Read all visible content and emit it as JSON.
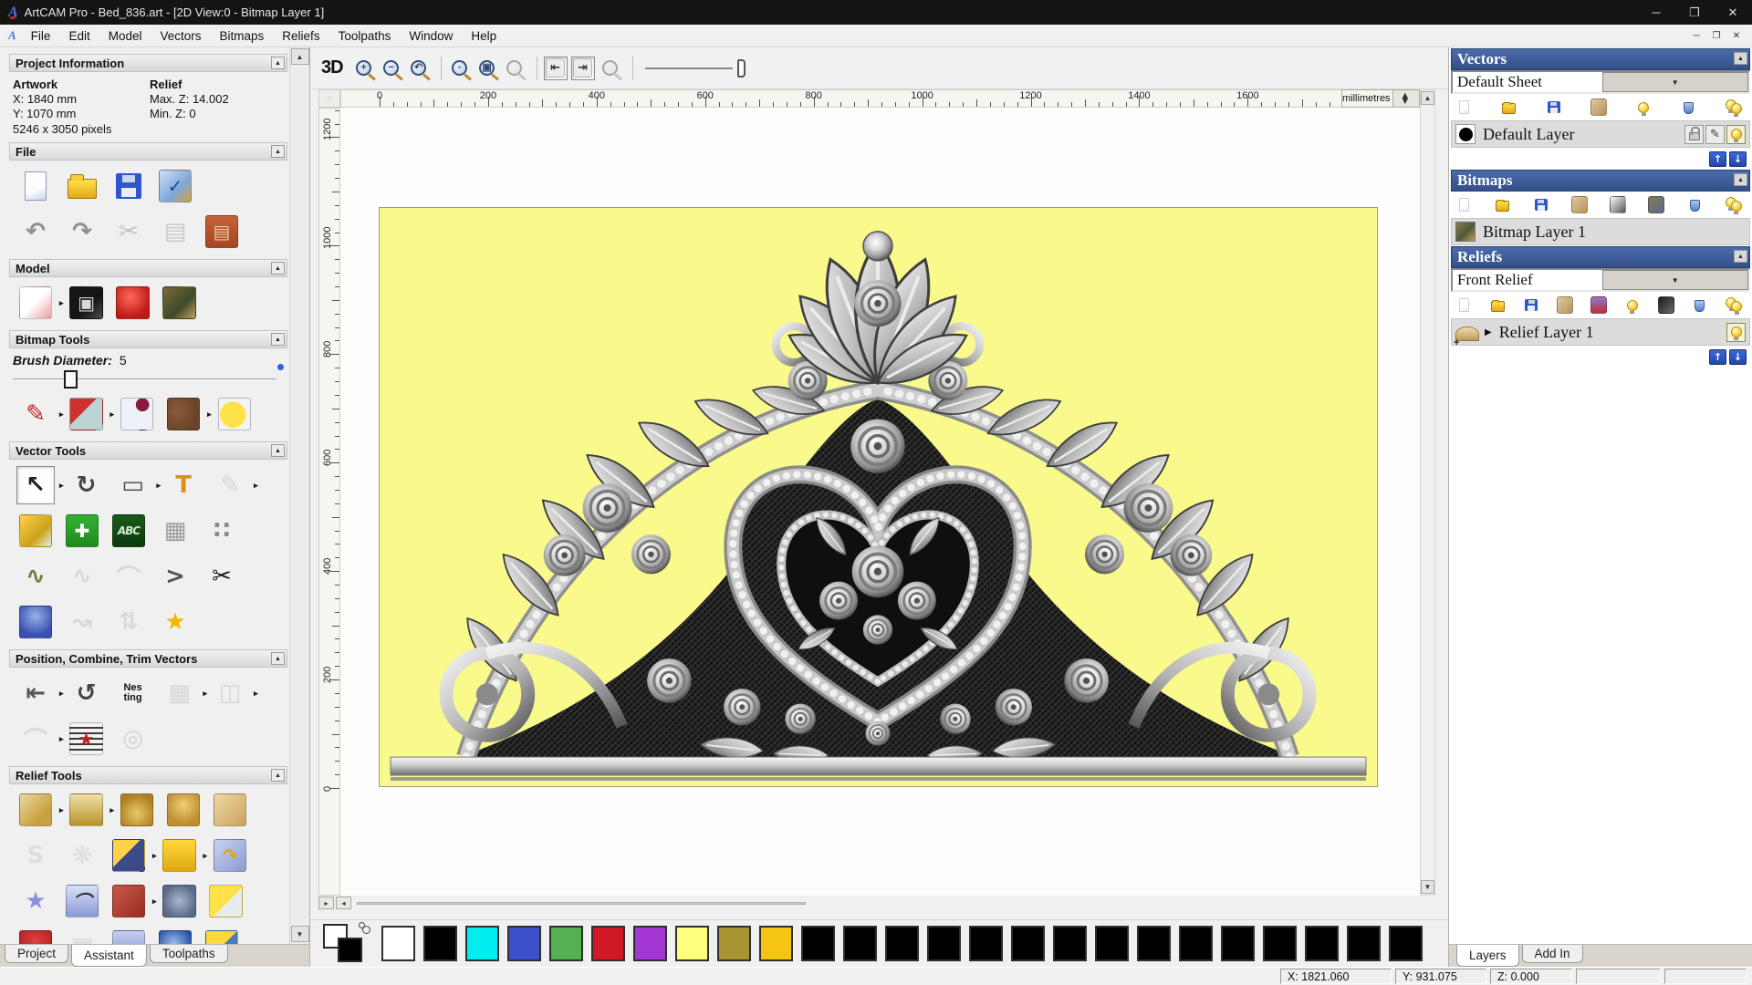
{
  "window": {
    "title": "ArtCAM Pro - Bed_836.art - [2D View:0 - Bitmap Layer 1]"
  },
  "menu": {
    "items": [
      "File",
      "Edit",
      "Model",
      "Vectors",
      "Bitmaps",
      "Reliefs",
      "Toolpaths",
      "Window",
      "Help"
    ]
  },
  "left_panel": {
    "project_information": {
      "title": "Project Information",
      "artwork_label": "Artwork",
      "artwork_x": "X: 1840 mm",
      "artwork_y": "Y: 1070 mm",
      "pixels": "5246 x 3050 pixels",
      "relief_label": "Relief",
      "relief_max": "Max. Z: 14.002",
      "relief_min": "Min. Z: 0"
    },
    "file": {
      "title": "File",
      "rows": [
        [
          {
            "n": "new-model-icon",
            "k": "page"
          },
          {
            "n": "open-model-icon",
            "k": "folder"
          },
          {
            "n": "save-model-icon",
            "k": "floppy"
          },
          {
            "n": "model-properties-icon",
            "k": "thumb",
            "bg": "linear-gradient(135deg,#cfe0f5,#7da7d9 60%,#d7a43a)",
            "g": "✓",
            "c": "#1a4a9a"
          }
        ],
        [
          {
            "n": "undo-icon",
            "k": "glyph",
            "g": "↶",
            "c": "#8e8e8e"
          },
          {
            "n": "redo-icon",
            "k": "glyph",
            "g": "↷",
            "c": "#8e8e8e"
          },
          {
            "n": "cut-icon",
            "k": "glyph",
            "g": "✂",
            "c": "#8a8a8a",
            "gray": 1
          },
          {
            "n": "copy-icon",
            "k": "glyph",
            "g": "▤",
            "c": "#9a9a9a",
            "gray": 1
          },
          {
            "n": "paste-icon",
            "k": "thumb",
            "bg": "linear-gradient(180deg,#c4643a,#a84422)",
            "g": "▤",
            "c": "#e8cfa0"
          }
        ]
      ]
    },
    "model": {
      "title": "Model",
      "rows": [
        [
          {
            "n": "set-model-size-icon",
            "k": "thumb",
            "bg": "linear-gradient(135deg,#ffffff 50%,#e89ba0)",
            "fly": 1
          },
          {
            "n": "adjust-model-icon",
            "k": "thumb",
            "bg": "linear-gradient(135deg,#151515 60%,#4e4e4e)",
            "g": "▣",
            "c": "#d8d8d8"
          },
          {
            "n": "lighting-material-icon",
            "k": "thumb",
            "bg": "radial-gradient(circle at 42% 32%,#ff6a5a,#c01818 72%)"
          },
          {
            "n": "load-bitmap-icon",
            "k": "thumb",
            "bg": "linear-gradient(135deg,#7a6a3a,#3d4a2a 60%,#c7a15a)"
          }
        ]
      ]
    },
    "bitmap_tools": {
      "title": "Bitmap Tools",
      "brush_label": "Brush Diameter:",
      "brush_value": "5",
      "rows": [
        [
          {
            "n": "paint-brush-icon",
            "k": "glyph",
            "g": "✎",
            "c": "#c42020",
            "fly": 1
          },
          {
            "n": "flood-fill-icon",
            "k": "thumb",
            "bg": "linear-gradient(135deg,#d03030 42%,#bcd4d4 42%)",
            "fly": 1
          },
          {
            "n": "colour-picker-icon",
            "k": "thumb",
            "bg": "radial-gradient(circle at 68% 20%,#8a1a3a 20%,#eef2f8 21%)"
          },
          {
            "n": "palette-icon",
            "k": "thumb",
            "bg": "radial-gradient(circle at 32% 42%,#8a5a3a,#6a4428 72%)",
            "fly": 1
          },
          {
            "n": "bitmap-to-vector-icon",
            "k": "thumb",
            "bg": "radial-gradient(circle at 45% 52%,#ffe24a 55%,#f2f4f8 56%)"
          }
        ]
      ]
    },
    "vector_tools": {
      "title": "Vector Tools",
      "rows": [
        [
          {
            "n": "select-vectors-icon",
            "k": "glyph",
            "g": "↖",
            "c": "#222",
            "pressed": 1,
            "fly": 1
          },
          {
            "n": "transform-vectors-icon",
            "k": "glyph",
            "g": "↻",
            "c": "#444"
          },
          {
            "n": "create-rectangle-icon",
            "k": "glyph",
            "g": "▭",
            "c": "#444",
            "fly": 1
          },
          {
            "n": "create-text-icon",
            "k": "glyph",
            "g": "T",
            "c": "#e09010"
          },
          {
            "n": "vector-doctor-icon",
            "k": "glyph",
            "g": "✎",
            "c": "#b8b8b8",
            "gray": 1,
            "fly": 1
          }
        ],
        [
          {
            "n": "measure-tool-icon",
            "k": "thumb",
            "bg": "linear-gradient(135deg,#ffd24a,#caa21a 62%,#ececec)"
          },
          {
            "n": "node-editing-icon",
            "k": "thumb",
            "bg": "linear-gradient(180deg,#35b335,#1f8a1f)",
            "g": "✚",
            "c": "#fff"
          },
          {
            "n": "text-tool-icon",
            "k": "thumb",
            "bg": "linear-gradient(180deg,#1a5a1a,#0c3a0c)",
            "g": "ABC",
            "c": "#cfe8cf",
            "sm": 1
          },
          {
            "n": "fit-vectors-grid-icon",
            "k": "glyph",
            "g": "▦",
            "c": "#9a9a9a"
          },
          {
            "n": "paste-along-vector-icon",
            "k": "glyph",
            "g": "∷",
            "c": "#8a8a8a"
          }
        ],
        [
          {
            "n": "create-polyline-icon",
            "k": "glyph",
            "g": "∿",
            "c": "#7a7a3a"
          },
          {
            "n": "fit-curve-icon",
            "k": "glyph",
            "g": "∿",
            "c": "#bdbdbd",
            "gray": 1
          },
          {
            "n": "create-arc-icon",
            "k": "glyph",
            "g": "⌒",
            "c": "#bdbdbd",
            "gray": 1
          },
          {
            "n": "polyline-angle-icon",
            "k": "glyph",
            "g": ">",
            "c": "#555"
          },
          {
            "n": "trim-vectors-icon",
            "k": "glyph",
            "g": "✂",
            "c": "#1a1a1a"
          }
        ],
        [
          {
            "n": "fillet-tool-icon",
            "k": "thumb",
            "bg": "radial-gradient(circle at 50% 32%,#9ab0e8,#3a50b0 72%)"
          },
          {
            "n": "smooth-polyline-icon",
            "k": "glyph",
            "g": "↝",
            "c": "#bdbdbd",
            "gray": 1
          },
          {
            "n": "mirror-vectors-icon",
            "k": "glyph",
            "g": "⇅",
            "c": "#bdbdbd",
            "gray": 1
          },
          {
            "n": "create-star-icon",
            "k": "glyph",
            "g": "★",
            "c": "#f0b800"
          }
        ]
      ]
    },
    "position_tools": {
      "title": "Position, Combine, Trim Vectors",
      "rows": [
        [
          {
            "n": "align-vectors-icon",
            "k": "glyph",
            "g": "⇤",
            "c": "#555",
            "fly": 1
          },
          {
            "n": "text-on-curve-icon",
            "k": "glyph",
            "g": "↺",
            "c": "#444"
          },
          {
            "n": "nesting-icon",
            "k": "text2",
            "lines": [
              "Nes",
              "ting"
            ]
          },
          {
            "n": "block-copy-icon",
            "k": "glyph",
            "g": "▦",
            "c": "#b8b8b8",
            "gray": 1,
            "fly": 1
          },
          {
            "n": "weld-vectors-icon",
            "k": "glyph",
            "g": "◫",
            "c": "#b8b8b8",
            "gray": 1,
            "fly": 1
          }
        ],
        [
          {
            "n": "join-vectors-icon",
            "k": "glyph",
            "g": "⌒",
            "c": "#bdbdbd",
            "gray": 1,
            "fly": 1
          },
          {
            "n": "vector-texture-icon",
            "k": "thumb",
            "bg": "repeating-linear-gradient(0deg,#f2f2f2 0 4px,#3a3a3a 4px 6px)",
            "g": "★",
            "c": "#c22020"
          },
          {
            "n": "interlock-vectors-icon",
            "k": "glyph",
            "g": "◎",
            "c": "#b0b0b0",
            "gray": 1
          }
        ]
      ]
    },
    "relief_tools": {
      "title": "Relief Tools",
      "rows": [
        [
          {
            "n": "calculate-relief-icon",
            "k": "thumb",
            "bg": "linear-gradient(135deg,#ead9a2,#c8a040 70%)",
            "fly": 1
          },
          {
            "n": "create-relief-bar-icon",
            "k": "thumb",
            "bg": "linear-gradient(180deg,#f0e0a8,#b8922a)",
            "fly": 1
          },
          {
            "n": "merge-add-relief-icon",
            "k": "thumb",
            "bg": "radial-gradient(circle at 50% 62%,#e8c86a,#b08020 76%)"
          },
          {
            "n": "merge-highest-relief-icon",
            "k": "thumb",
            "bg": "radial-gradient(circle at 50% 35%,#f0cc7a,#c09030 70%)"
          },
          {
            "n": "merge-lowest-relief-icon",
            "k": "thumb",
            "bg": "linear-gradient(135deg,#f0d8a8,#caa35a)"
          }
        ],
        [
          {
            "n": "sculpting-icon",
            "k": "glyph",
            "g": "S",
            "c": "#c8c8c8",
            "gray": 1
          },
          {
            "n": "weave-wizard-icon",
            "k": "glyph",
            "g": "❋",
            "c": "#c8c8c8",
            "gray": 1
          },
          {
            "n": "emboss-relief-icon",
            "k": "thumb",
            "bg": "linear-gradient(135deg,#ffd24a 44%,#3a4a8a 44%)",
            "fly": 1
          },
          {
            "n": "zero-plane-icon",
            "k": "thumb",
            "bg": "linear-gradient(180deg,#ffd83a,#e0a810)",
            "fly": 1
          },
          {
            "n": "offset-relief-icon",
            "k": "thumb",
            "bg": "linear-gradient(135deg,#c8d4f0,#8a9ad0)",
            "g": "↷",
            "c": "#e0a810"
          }
        ],
        [
          {
            "n": "star-relief-icon",
            "k": "glyph",
            "g": "★",
            "c": "#8a90dd"
          },
          {
            "n": "shape-editor-icon",
            "k": "thumb",
            "bg": "linear-gradient(180deg,#d8e0f5,#8a9ad8)",
            "g": "⌒",
            "c": "#333"
          },
          {
            "n": "turn-model-icon",
            "k": "thumb",
            "bg": "linear-gradient(135deg,#c85a4a,#9a2a20)",
            "fly": 1
          },
          {
            "n": "texture-relief-icon",
            "k": "thumb",
            "bg": "radial-gradient(circle,#aab8cc,#5a6a88 76%)"
          },
          {
            "n": "relief-from-layers-icon",
            "k": "thumb",
            "bg": "linear-gradient(135deg,#ffe24a 55%,#e8ecf2 55%)"
          }
        ],
        [
          {
            "n": "red-relief-tool-icon",
            "k": "thumb",
            "bg": "radial-gradient(circle at 50% 32%,#e04040,#a01818)"
          },
          {
            "n": "isolate-relief-icon",
            "k": "glyph",
            "g": "▦",
            "c": "#bdbdbd",
            "gray": 1
          },
          {
            "n": "pyramid-relief-icon",
            "k": "thumb",
            "bg": "linear-gradient(180deg,#c8d0f0,#7a86c8)"
          },
          {
            "n": "texture-ball-icon",
            "k": "thumb",
            "bg": "radial-gradient(circle at 45% 40%,#9ac0f0,#2a50a0 72%)"
          },
          {
            "n": "two-rail-sweep-icon",
            "k": "thumb",
            "bg": "linear-gradient(135deg,#ffd83a 50%,#4a7ac0 50%)"
          }
        ]
      ]
    },
    "tabs": [
      "Project",
      "Assistant",
      "Toolpaths"
    ]
  },
  "view_toolbar": {
    "to_3d": "3D",
    "items": [
      {
        "n": "zoom-in-icon",
        "k": "mag",
        "g": "+"
      },
      {
        "n": "zoom-out-icon",
        "k": "mag",
        "g": "−"
      },
      {
        "n": "zoom-previous-icon",
        "k": "mag",
        "g": "↶"
      },
      {
        "k": "sep"
      },
      {
        "n": "zoom-box-icon",
        "k": "mag",
        "g": "▫"
      },
      {
        "n": "zoom-fit-icon",
        "k": "mag",
        "g": "▣"
      },
      {
        "n": "zoom-selection-icon",
        "k": "mag",
        "g": "",
        "gray": 1
      },
      {
        "k": "sep"
      },
      {
        "n": "toggle-bitmap-view-icon",
        "k": "thumb",
        "bg": "#ececec",
        "g": "⇤",
        "c": "#333",
        "pressed": 1
      },
      {
        "n": "toggle-relief-view-icon",
        "k": "thumb",
        "bg": "#ececec",
        "g": "⇥",
        "c": "#333",
        "pressed": 1
      },
      {
        "n": "preview-relief-icon",
        "k": "mag",
        "g": "",
        "gray": 1
      },
      {
        "k": "sep"
      },
      {
        "n": "contrast-slider",
        "k": "slider"
      }
    ]
  },
  "ruler": {
    "unit": "millimetres",
    "h_labels": [
      0,
      200,
      400,
      600,
      800,
      1000,
      1200,
      1400,
      1600
    ],
    "v_labels": [
      0,
      200,
      400,
      600,
      800,
      1000,
      1200
    ]
  },
  "right_panel": {
    "vectors": {
      "title": "Vectors",
      "sheet_value": "Default Sheet",
      "icons": [
        {
          "n": "new-sheet-icon",
          "k": "page",
          "gray": 1
        },
        {
          "n": "open-vectors-icon",
          "k": "folder"
        },
        {
          "n": "save-vectors-icon",
          "k": "floppy"
        },
        {
          "n": "merge-vector-layers-icon",
          "k": "thumb",
          "bg": "linear-gradient(135deg,#e0c9a0,#b89258)"
        },
        {
          "n": "toggle-layer-visibility-icon",
          "k": "bulb"
        },
        {
          "n": "delete-vector-layer-icon",
          "k": "trash"
        },
        {
          "n": "toggle-all-layers-icon",
          "k": "bulbs"
        }
      ],
      "layer": {
        "name": "Default Layer"
      }
    },
    "bitmaps": {
      "title": "Bitmaps",
      "icons": [
        {
          "n": "new-bitmap-layer-icon",
          "k": "page",
          "gray": 1
        },
        {
          "n": "open-bitmap-icon",
          "k": "folder"
        },
        {
          "n": "save-bitmap-icon",
          "k": "floppy"
        },
        {
          "n": "merge-bitmap-layers-icon",
          "k": "thumb",
          "bg": "linear-gradient(135deg,#e0c9a0,#b89258)"
        },
        {
          "n": "greyscale-bitmap-icon",
          "k": "thumb",
          "bg": "linear-gradient(135deg,#fdfdfd,#555)"
        },
        {
          "n": "bitmap-from-relief-icon",
          "k": "thumb",
          "bg": "linear-gradient(135deg,#8a7a4a,#5a6a9a)"
        },
        {
          "n": "delete-bitmap-layer-icon",
          "k": "trash"
        },
        {
          "n": "toggle-all-bitmaps-icon",
          "k": "bulbs"
        }
      ],
      "layer": {
        "name": "Bitmap Layer 1"
      }
    },
    "reliefs": {
      "title": "Reliefs",
      "relief_value": "Front Relief",
      "icons": [
        {
          "n": "new-relief-layer-icon",
          "k": "page",
          "gray": 1
        },
        {
          "n": "open-relief-icon",
          "k": "folder"
        },
        {
          "n": "save-relief-icon",
          "k": "floppy"
        },
        {
          "n": "merge-relief-layers-icon",
          "k": "thumb",
          "bg": "linear-gradient(135deg,#e0c9a0,#b89258)"
        },
        {
          "n": "transfer-relief-icon",
          "k": "thumb",
          "bg": "linear-gradient(180deg,#8a7ad0,#c03030)"
        },
        {
          "n": "relief-visibility-icon",
          "k": "bulb"
        },
        {
          "n": "relief-greyscale-icon",
          "k": "thumb",
          "bg": "linear-gradient(135deg,#1a1a1a,#6a6a6a)"
        },
        {
          "n": "delete-relief-layer-icon",
          "k": "trash"
        },
        {
          "n": "toggle-all-reliefs-icon",
          "k": "bulbs"
        }
      ],
      "layer": {
        "name": "Relief Layer 1"
      }
    },
    "tabs": [
      "Layers",
      "Add In"
    ]
  },
  "palette": {
    "swatches": [
      "#ffffff",
      "#000000",
      "#00eeee",
      "#3c50cc",
      "#54b050",
      "#d01826",
      "#a436d4",
      "#ffff7e",
      "#a89430",
      "#f6c414",
      "#000000",
      "#000000",
      "#000000",
      "#000000",
      "#000000",
      "#000000",
      "#000000",
      "#000000",
      "#000000",
      "#000000",
      "#000000",
      "#000000",
      "#000000",
      "#000000",
      "#000000"
    ]
  },
  "canvas": {
    "background": "#FAFA8C"
  },
  "status_bar": {
    "x": "X: 1821.060",
    "y": "Y: 931.075",
    "z": "Z: 0.000"
  }
}
